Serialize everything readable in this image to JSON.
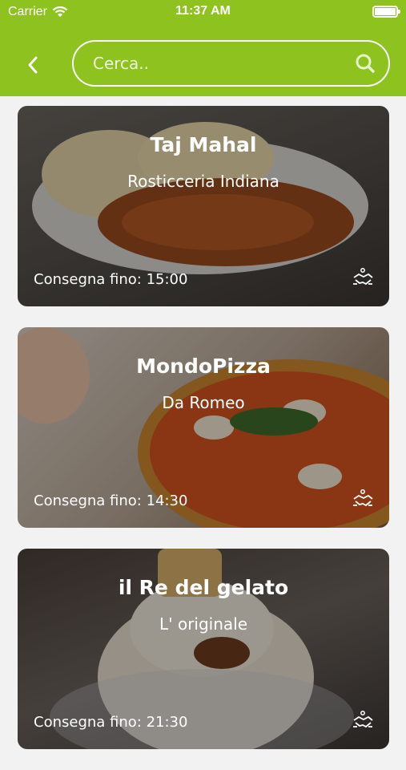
{
  "status_bar": {
    "carrier": "Carrier",
    "time": "11:37 AM"
  },
  "search": {
    "placeholder": "Cerca.."
  },
  "restaurants": [
    {
      "name": "Taj Mahal",
      "subtitle": "Rosticceria Indiana",
      "delivery": "Consegna fino: 15:00"
    },
    {
      "name": "MondoPizza",
      "subtitle": "Da Romeo",
      "delivery": "Consegna fino: 14:30"
    },
    {
      "name": "il Re del gelato",
      "subtitle": "L' originale",
      "delivery": "Consegna fino: 21:30"
    }
  ],
  "colors": {
    "header": "#8dc21f",
    "text_on_card": "#ffffff"
  },
  "icons": {
    "back": "chevron-left-icon",
    "search": "search-icon",
    "delivery": "handshake-icon",
    "wifi": "wifi-icon",
    "battery": "battery-icon"
  }
}
